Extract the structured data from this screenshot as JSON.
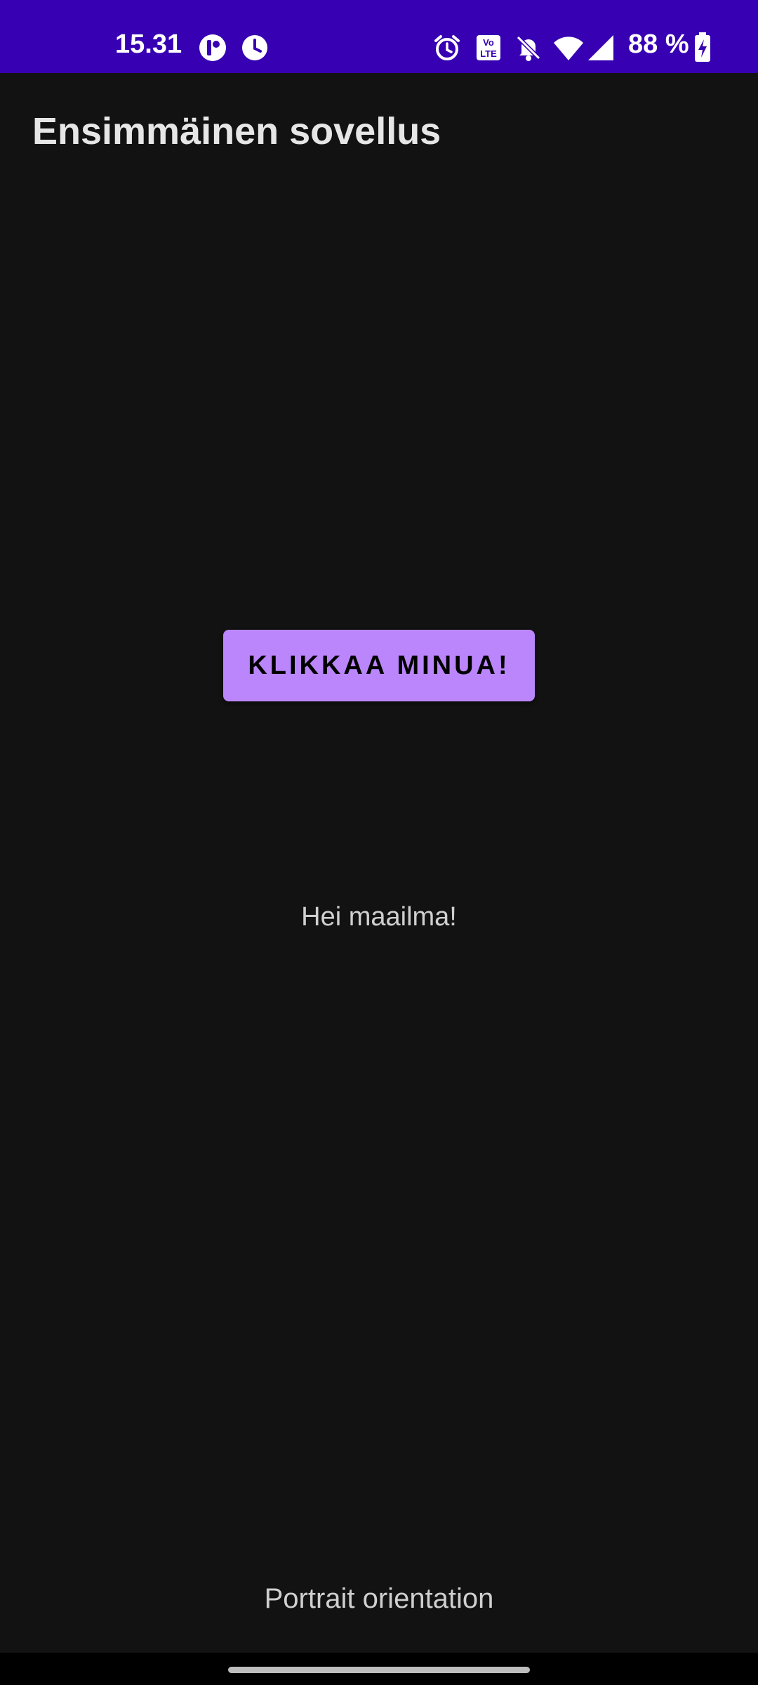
{
  "status_bar": {
    "time": "15.31",
    "battery": "88 %",
    "background_color": "#3700B3",
    "icons": [
      "app-notification-icon",
      "clock-icon",
      "alarm-icon",
      "volte-icon",
      "notifications-off-icon",
      "wifi-icon",
      "signal-icon",
      "battery-charging-icon"
    ]
  },
  "app_bar": {
    "title": "Ensimmäinen sovellus"
  },
  "main": {
    "button_label": "KLIKKAA MINUA!",
    "button_color": "#BB86FC",
    "hello_text": "Hei maailma!",
    "orientation_text": "Portrait orientation"
  },
  "theme": {
    "background": "#121212"
  }
}
